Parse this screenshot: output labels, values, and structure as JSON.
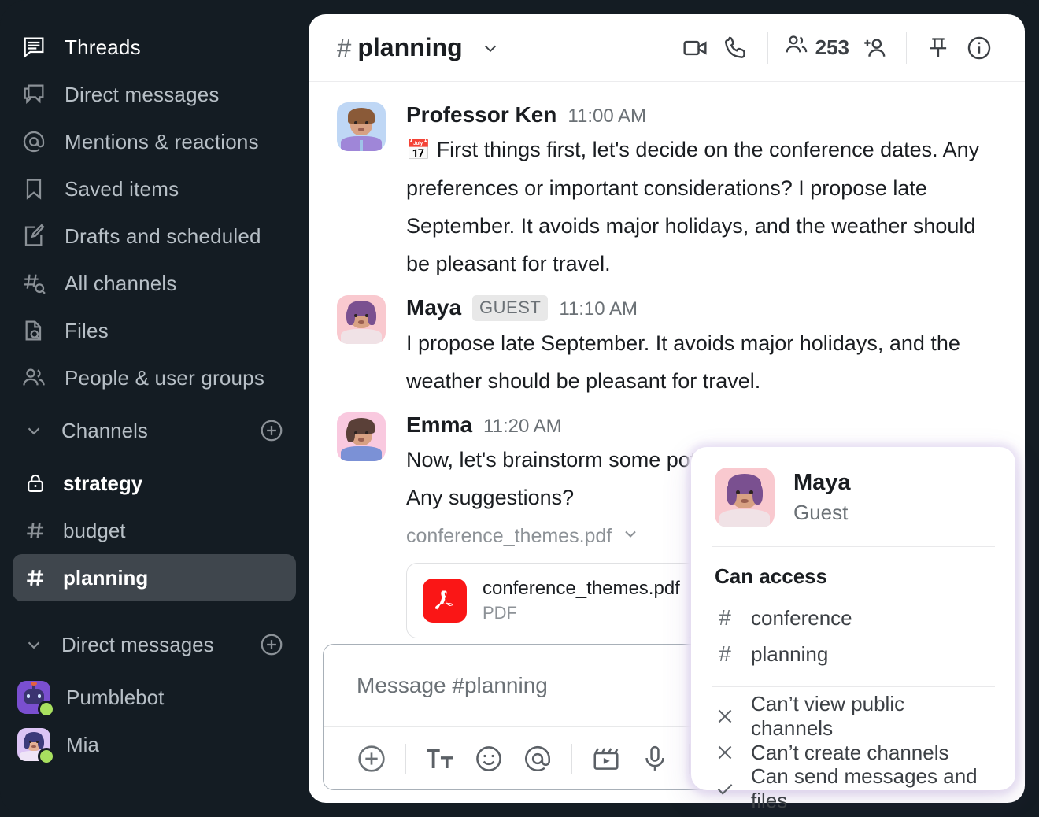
{
  "sidebar": {
    "nav": [
      {
        "label": "Threads",
        "icon": "threads-icon"
      },
      {
        "label": "Direct messages",
        "icon": "direct-messages-icon"
      },
      {
        "label": "Mentions & reactions",
        "icon": "mentions-icon"
      },
      {
        "label": "Saved items",
        "icon": "bookmark-icon"
      },
      {
        "label": "Drafts and scheduled",
        "icon": "draft-pencil-icon"
      },
      {
        "label": "All channels",
        "icon": "all-channels-search-icon"
      },
      {
        "label": "Files",
        "icon": "file-search-icon"
      },
      {
        "label": "People & user groups",
        "icon": "people-icon"
      }
    ],
    "channels_section": {
      "title": "Channels",
      "add_label": "+"
    },
    "channels": [
      {
        "name": "strategy",
        "icon": "lock-icon",
        "active": false,
        "unread": true
      },
      {
        "name": "budget",
        "icon": "hash-icon",
        "active": false,
        "unread": false
      },
      {
        "name": "planning",
        "icon": "hash-icon",
        "active": true,
        "unread": false
      }
    ],
    "dm_section": {
      "title": "Direct messages",
      "add_label": "+"
    },
    "dms": [
      {
        "name": "Pumblebot",
        "status": "online"
      },
      {
        "name": "Mia",
        "status": "online"
      }
    ]
  },
  "header": {
    "hash": "#",
    "channel": "planning",
    "member_count": "253",
    "icons": [
      "video-camera-icon",
      "phone-icon",
      "members-icon",
      "add-person-icon",
      "pin-icon",
      "info-icon"
    ]
  },
  "messages": [
    {
      "author": "Professor Ken",
      "badge": "",
      "time": "11:00 AM",
      "emoji": "📅",
      "text": "First things first, let's decide on the conference dates. Any preferences or important considerations? I propose late September. It avoids major holidays, and the weather should be pleasant for travel.",
      "avatar": "professor-ken-avatar"
    },
    {
      "author": "Maya",
      "badge": "GUEST",
      "time": "11:10 AM",
      "emoji": "",
      "text": "I propose late September. It avoids major holidays, and the weather should be pleasant for travel.",
      "avatar": "maya-avatar"
    },
    {
      "author": "Emma",
      "badge": "",
      "time": "11:20 AM",
      "emoji": "",
      "text": "Now, let's brainstorm some pot",
      "text_line2": "Any suggestions?",
      "avatar": "emma-avatar"
    }
  ],
  "attachment": {
    "filename_line": "conference_themes.pdf",
    "card_filename": "conference_themes.pdf",
    "card_filetype": "PDF",
    "icon": "pdf-icon"
  },
  "composer": {
    "placeholder": "Message #planning",
    "buttons": [
      "plus-icon",
      "text-format-icon",
      "emoji-icon",
      "mention-icon",
      "video-clip-icon",
      "microphone-icon"
    ]
  },
  "popover": {
    "name": "Maya",
    "role": "Guest",
    "access_title": "Can access",
    "channels": [
      {
        "hash": "#",
        "name": "conference"
      },
      {
        "hash": "#",
        "name": "planning"
      }
    ],
    "permissions": [
      {
        "state": "deny",
        "label": "Can’t view public channels"
      },
      {
        "state": "deny",
        "label": "Can’t create channels"
      },
      {
        "state": "allow",
        "label": "Can send messages and files"
      }
    ]
  },
  "colors": {
    "sidebar_bg": "#141c23",
    "accent_online": "#a8e05f",
    "pdf_red": "#fa1616",
    "active_channel": "#3f464d"
  }
}
